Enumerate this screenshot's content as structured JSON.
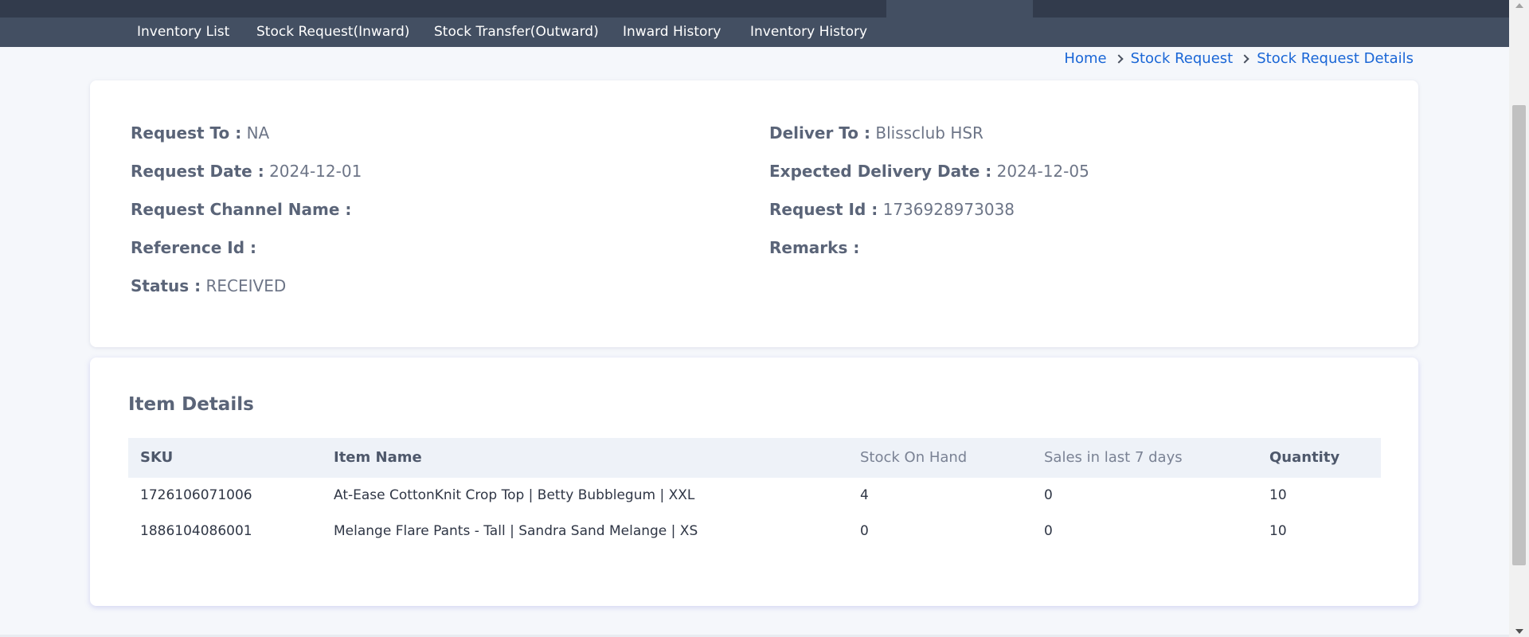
{
  "nav": {
    "items": [
      {
        "label": "Inventory List"
      },
      {
        "label": "Stock Request(Inward)"
      },
      {
        "label": "Stock Transfer(Outward)"
      },
      {
        "label": "Inward History"
      },
      {
        "label": "Inventory History"
      }
    ]
  },
  "breadcrumb": {
    "items": [
      {
        "label": "Home"
      },
      {
        "label": "Stock Request"
      },
      {
        "label": "Stock Request Details"
      }
    ],
    "separator_icon": "chevron-right-icon"
  },
  "request": {
    "left": [
      {
        "label": "Request To :",
        "value": "NA"
      },
      {
        "label": "Request Date :",
        "value": "2024-12-01"
      },
      {
        "label": "Request Channel Name :",
        "value": ""
      },
      {
        "label": "Reference Id :",
        "value": ""
      },
      {
        "label": "Status :",
        "value": "RECEIVED"
      }
    ],
    "right": [
      {
        "label": "Deliver To :",
        "value": "Blissclub HSR"
      },
      {
        "label": "Expected Delivery Date :",
        "value": "2024-12-05"
      },
      {
        "label": "Request Id :",
        "value": "1736928973038"
      },
      {
        "label": "Remarks :",
        "value": ""
      }
    ]
  },
  "items": {
    "title": "Item Details",
    "columns": [
      "SKU",
      "Item Name",
      "Stock On Hand",
      "Sales in last 7 days",
      "Quantity"
    ],
    "rows": [
      [
        "1726106071006",
        "At-Ease CottonKnit Crop Top | Betty Bubblegum | XXL",
        "4",
        "0",
        "10"
      ],
      [
        "1886104086001",
        "Melange Flare Pants - Tall | Sandra Sand Melange | XS",
        "0",
        "0",
        "10"
      ]
    ]
  },
  "colors": {
    "topbar": "#323b4c",
    "navbar": "#434f62",
    "link": "#1a66d6",
    "page_bg": "#f5f7fb"
  }
}
